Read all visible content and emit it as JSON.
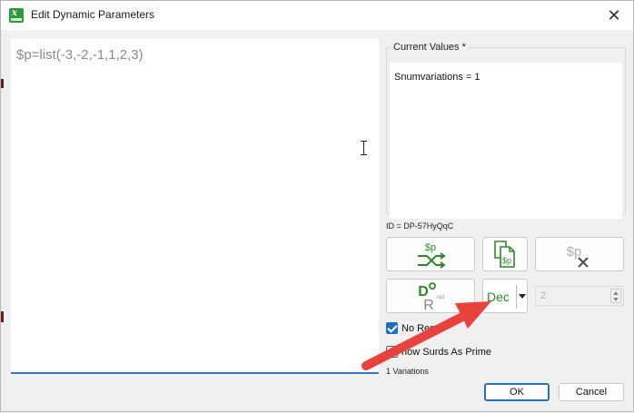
{
  "window": {
    "title": "Edit Dynamic Parameters"
  },
  "editor": {
    "text": "$p=list(-3,-2,-1,1,2,3)"
  },
  "current_values": {
    "legend": "Current Values *",
    "text": "Snumvariations = 1"
  },
  "id_label": "ID = DP-57HyQqC",
  "buttons": {
    "shuffle_icon_text": "$p",
    "copy_icon_text": "$p",
    "delete_icon_text": "$p",
    "deg_top": "D",
    "deg_bottom": "R",
    "deg_sub": "rad",
    "dec_label": "Dec",
    "ok_label": "OK",
    "cancel_label": "Cancel"
  },
  "stepper": {
    "value": "2"
  },
  "checkboxes": {
    "no_render_label": "No Rend",
    "show_surds_label": "how Surds As Prime"
  },
  "variations_label": "1 Variations",
  "colors": {
    "accent": "#2c8a2c",
    "focus": "#2b6fc0",
    "annotation_arrow": "#e8423c"
  }
}
